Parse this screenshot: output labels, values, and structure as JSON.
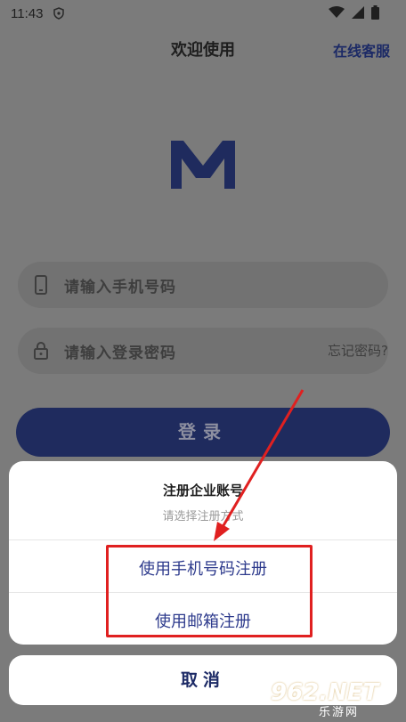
{
  "status": {
    "time": "11:43"
  },
  "header": {
    "title": "欢迎使用",
    "service_label": "在线客服"
  },
  "form": {
    "phone_placeholder": "请输入手机号码",
    "password_placeholder": "请输入登录密码",
    "forgot_label": "忘记密码?",
    "login_label": "登录"
  },
  "sheet": {
    "title": "注册企业账号",
    "subtitle": "请选择注册方式",
    "options": [
      "使用手机号码注册",
      "使用邮箱注册"
    ],
    "cancel_label": "取消"
  },
  "watermark": {
    "main": "962.NET",
    "sub": "乐游网"
  },
  "colors": {
    "brand": "#1f2b5e",
    "accent_text": "#2d3a8c",
    "annotation": "#e02020"
  }
}
